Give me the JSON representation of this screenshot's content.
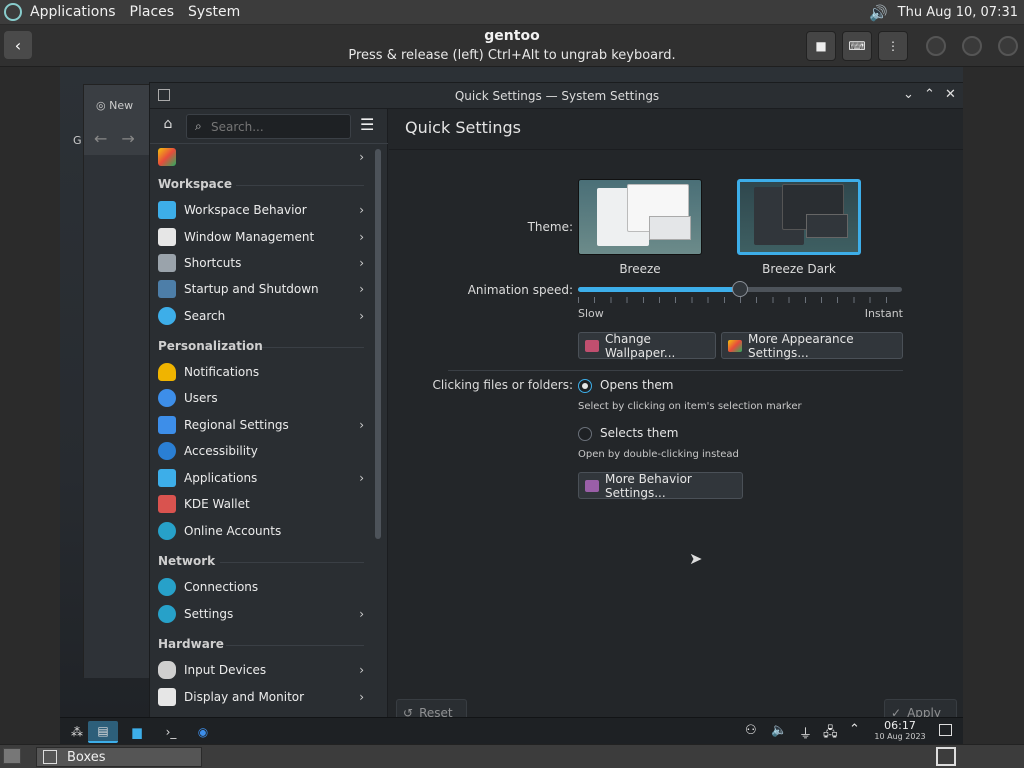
{
  "host_panel": {
    "menus": [
      "Applications",
      "Places",
      "System"
    ],
    "clock": "Thu Aug 10, 07:31"
  },
  "boxes": {
    "title": "gentoo",
    "subtitle": "Press & release (left) Ctrl+Alt to ungrab keyboard."
  },
  "bg_window": {
    "tab_label": "New",
    "side_letter": "G"
  },
  "settings_window": {
    "title": "Quick Settings — System Settings",
    "search_placeholder": "Search...",
    "sidebar": {
      "top_item": "",
      "categories": [
        {
          "name": "Workspace",
          "items": [
            {
              "label": "Workspace Behavior",
              "chevron": true,
              "color": "#3daee9"
            },
            {
              "label": "Window Management",
              "chevron": true,
              "color": "#e6e6e6"
            },
            {
              "label": "Shortcuts",
              "chevron": true,
              "color": "#9aa3ab"
            },
            {
              "label": "Startup and Shutdown",
              "chevron": true,
              "color": "#4d7ea8"
            },
            {
              "label": "Search",
              "chevron": true,
              "color": "#3daee9"
            }
          ]
        },
        {
          "name": "Personalization",
          "items": [
            {
              "label": "Notifications",
              "chevron": false,
              "color": "#f0b400"
            },
            {
              "label": "Users",
              "chevron": false,
              "color": "#3d8ee9"
            },
            {
              "label": "Regional Settings",
              "chevron": true,
              "color": "#3d8ee9"
            },
            {
              "label": "Accessibility",
              "chevron": false,
              "color": "#2a7fd4"
            },
            {
              "label": "Applications",
              "chevron": true,
              "color": "#3daee9"
            },
            {
              "label": "KDE Wallet",
              "chevron": false,
              "color": "#d9534f"
            },
            {
              "label": "Online Accounts",
              "chevron": false,
              "color": "#27a1c9"
            }
          ]
        },
        {
          "name": "Network",
          "items": [
            {
              "label": "Connections",
              "chevron": false,
              "color": "#27a1c9"
            },
            {
              "label": "Settings",
              "chevron": true,
              "color": "#27a1c9"
            }
          ]
        },
        {
          "name": "Hardware",
          "items": [
            {
              "label": "Input Devices",
              "chevron": true,
              "color": "#cfcfcf"
            },
            {
              "label": "Display and Monitor",
              "chevron": true,
              "color": "#e6e6e6"
            }
          ]
        }
      ]
    },
    "content": {
      "page_title": "Quick Settings",
      "theme_label": "Theme:",
      "themes": [
        {
          "name": "Breeze",
          "selected": false
        },
        {
          "name": "Breeze Dark",
          "selected": true
        }
      ],
      "animation_label": "Animation speed:",
      "animation_value": 0.5,
      "slow_label": "Slow",
      "instant_label": "Instant",
      "change_wallpaper": "Change Wallpaper...",
      "more_appearance": "More Appearance Settings...",
      "clicking_label": "Clicking files or folders:",
      "opens_them": "Opens them",
      "opens_hint": "Select by clicking on item's selection marker",
      "selects_them": "Selects them",
      "selects_hint": "Open by double-clicking instead",
      "more_behavior": "More Behavior Settings...",
      "reset": "Reset",
      "apply": "Apply"
    }
  },
  "plasma_taskbar": {
    "time": "06:17",
    "date": "10 Aug 2023"
  },
  "host_bottom": {
    "task_label": "Boxes"
  },
  "colors": {
    "accent": "#3daee9",
    "panel": "#3c3c3c",
    "window": "#232629"
  }
}
